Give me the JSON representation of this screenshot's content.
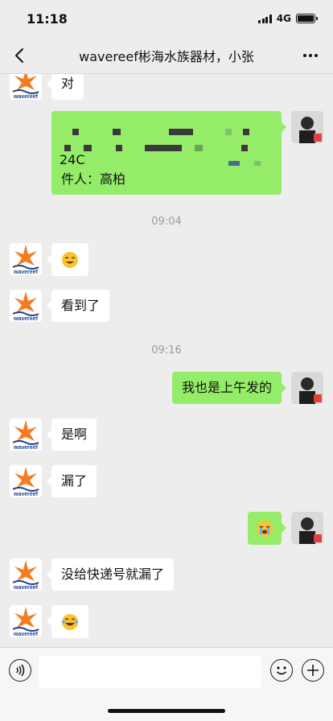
{
  "status": {
    "time": "11:18",
    "network": "4G"
  },
  "nav": {
    "title": "wavereef彬海水族器材，小张"
  },
  "contact": {
    "logo_text": "wavereef"
  },
  "messages": {
    "m0": "对",
    "m1_line1": "24C",
    "m1_line2": "件人：高柏",
    "t1": "09:04",
    "m3": "看到了",
    "t2": "09:16",
    "m4": "我也是上午发的",
    "m5": "是啊",
    "m6": "漏了",
    "m8": "没给快递号就漏了"
  },
  "input": {
    "value": ""
  },
  "colors": {
    "out_bubble": "#95ec69",
    "in_bubble": "#ffffff",
    "background": "#ededed",
    "logo_orange": "#f47b20",
    "logo_blue": "#1d3f8f"
  },
  "icons": {
    "back": "chevron-left-icon",
    "more": "more-icon",
    "voice": "voice-icon",
    "emoji": "emoji-icon",
    "plus": "plus-icon"
  }
}
